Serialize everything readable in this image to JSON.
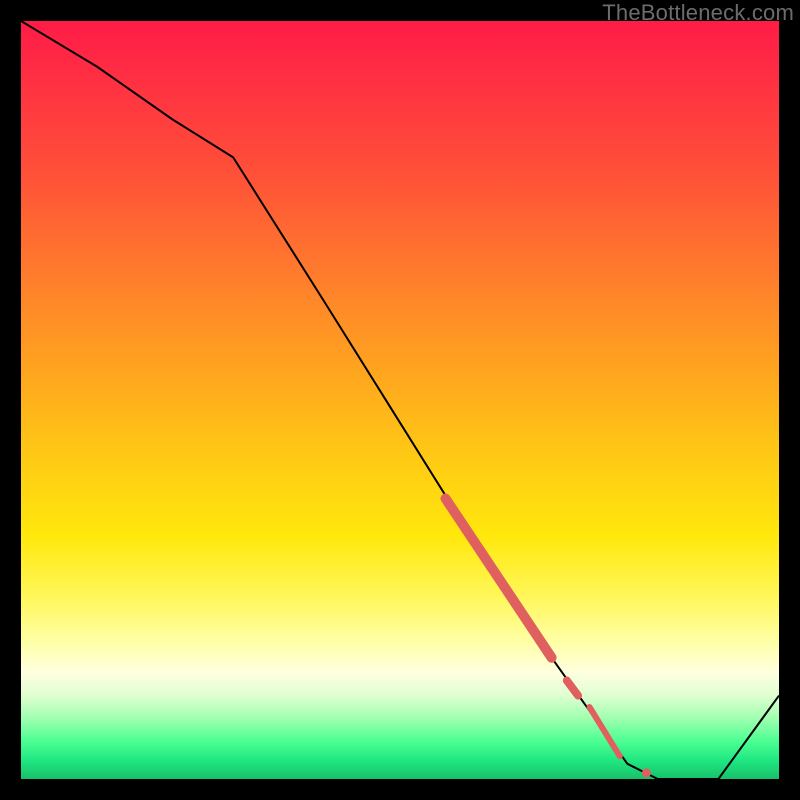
{
  "watermark": "TheBottleneck.com",
  "chart_data": {
    "type": "line",
    "title": "",
    "xlabel": "",
    "ylabel": "",
    "xlim": [
      0,
      100
    ],
    "ylim": [
      0,
      100
    ],
    "grid": false,
    "series": [
      {
        "name": "curve",
        "x": [
          0,
          10,
          20,
          28,
          40,
          50,
          60,
          70,
          80,
          84,
          88,
          92,
          100
        ],
        "y": [
          100,
          94,
          87,
          82,
          63,
          47,
          31,
          16,
          2,
          0,
          0,
          0,
          11
        ]
      }
    ],
    "marker_segments": [
      {
        "x0": 56,
        "y0": 37,
        "x1": 70,
        "y1": 16,
        "width": 10
      },
      {
        "x0": 72,
        "y0": 13,
        "x1": 73.5,
        "y1": 11,
        "width": 8
      },
      {
        "x0": 75,
        "y0": 9.5,
        "x1": 79,
        "y1": 3,
        "width": 6
      }
    ],
    "marker_points": [
      {
        "x": 82.5,
        "y": 0.8,
        "r": 4.5
      }
    ],
    "marker_color": "#e06060",
    "line_color": "#000000",
    "line_width": 2
  }
}
